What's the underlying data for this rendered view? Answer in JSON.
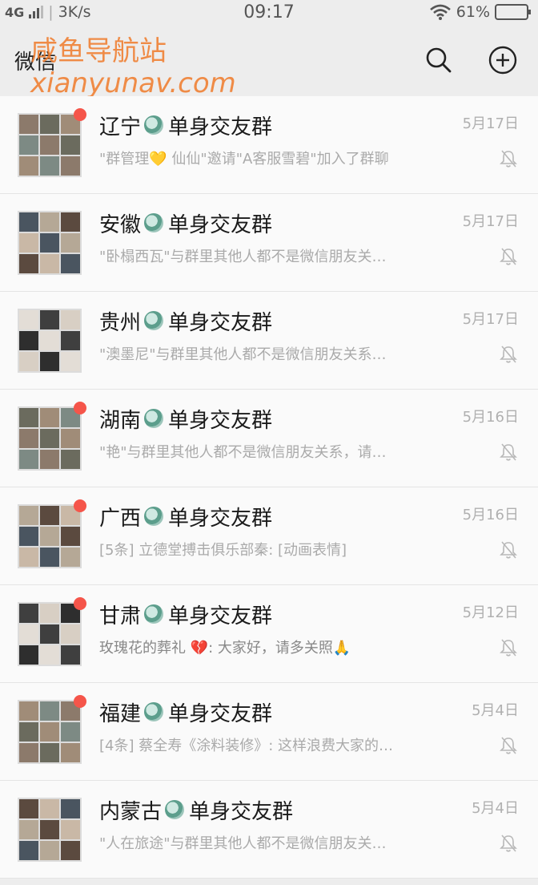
{
  "status_bar": {
    "network": "4G",
    "speed": "3K/s",
    "time": "09:17",
    "battery": "61%",
    "battery_level": 0.61
  },
  "header": {
    "title": "微信",
    "search_icon": "search-icon",
    "add_icon": "plus-circle-icon"
  },
  "watermark": {
    "cn": "咸鱼导航站",
    "url": "xianyunav.com"
  },
  "chats": [
    {
      "prefix": "辽宁",
      "group": "单身交友群",
      "time": "5月17日",
      "preview": "\"群管理💛 仙仙\"邀请\"A客服雪碧\"加入了群聊",
      "unread": true,
      "muted": true
    },
    {
      "prefix": "安徽",
      "group": "单身交友群",
      "time": "5月17日",
      "preview": "\"卧榻西瓦\"与群里其他人都不是微信朋友关…",
      "unread": false,
      "muted": true
    },
    {
      "prefix": "贵州",
      "group": "单身交友群",
      "time": "5月17日",
      "preview": "\"澳墨尼\"与群里其他人都不是微信朋友关系…",
      "unread": false,
      "muted": true
    },
    {
      "prefix": "湖南",
      "group": "单身交友群",
      "time": "5月16日",
      "preview": "\"艳\"与群里其他人都不是微信朋友关系，请…",
      "unread": true,
      "muted": true
    },
    {
      "prefix": "广西",
      "group": "单身交友群",
      "time": "5月16日",
      "preview": "[5条] 立德堂搏击俱乐部秦: [动画表情]",
      "unread": true,
      "muted": true
    },
    {
      "prefix": "甘肃",
      "group": "单身交友群",
      "time": "5月12日",
      "preview": "玫瑰花的葬礼 💔: 大家好，请多关照🙏",
      "unread": true,
      "muted": true
    },
    {
      "prefix": "福建",
      "group": "单身交友群",
      "time": "5月4日",
      "preview": "[4条] 蔡全寿《涂料装修》: 这样浪费大家的…",
      "unread": true,
      "muted": true
    },
    {
      "prefix": "内蒙古",
      "group": "单身交友群",
      "time": "5月4日",
      "preview": "\"人在旅途\"与群里其他人都不是微信朋友关…",
      "unread": false,
      "muted": true
    }
  ],
  "colors": {
    "unread_dot": "#f5554a",
    "watermark": "#f07a2a"
  }
}
